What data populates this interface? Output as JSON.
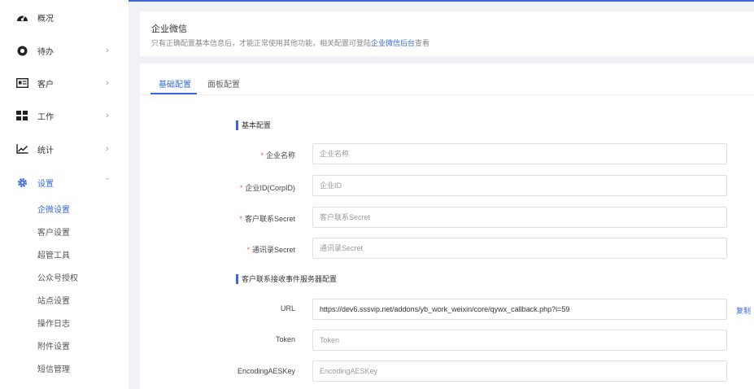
{
  "sidebar": {
    "items": [
      {
        "label": "概况",
        "icon": "dashboard-icon"
      },
      {
        "label": "待办",
        "icon": "todo-icon"
      },
      {
        "label": "客户",
        "icon": "customer-card-icon"
      },
      {
        "label": "工作",
        "icon": "grid-icon"
      },
      {
        "label": "统计",
        "icon": "chart-line-icon"
      },
      {
        "label": "设置",
        "icon": "gear-icon"
      }
    ],
    "arrow_right": "›",
    "arrow_down": "ˇ",
    "sub_items": [
      "企微设置",
      "客户设置",
      "超管工具",
      "公众号授权",
      "站点设置",
      "操作日志",
      "附件设置",
      "短信管理"
    ]
  },
  "header": {
    "title": "企业微信",
    "desc_before": "只有正确配置基本信息后，才能正常使用其他功能，相关配置可登陆",
    "link": "企业微信后台",
    "desc_after": "查看"
  },
  "tabs": [
    "基础配置",
    "面板配置"
  ],
  "sections": {
    "basic": "基本配置",
    "callback": "客户联系接收事件服务器配置"
  },
  "form": {
    "required_mark": "*",
    "corp_name": {
      "label": "企业名称",
      "placeholder": "企业名称"
    },
    "corp_id": {
      "label": "企业ID(CorpID)",
      "placeholder": "企业ID"
    },
    "contact_secret": {
      "label": "客户联系Secret",
      "placeholder": "客户联系Secret"
    },
    "address_secret": {
      "label": "通讯录Secret",
      "placeholder": "通讯录Secret"
    },
    "url": {
      "label": "URL",
      "value": "https://dev6.sssvip.net/addons/yb_work_weixin/core/qywx_callback.php?i=59"
    },
    "token": {
      "label": "Token",
      "placeholder": "Token"
    },
    "aes_key": {
      "label": "EncodingAESKey",
      "placeholder": "EncodingAESKey"
    },
    "copy_label": "复制"
  },
  "colors": {
    "accent": "#3a68d8",
    "required": "#e85555"
  }
}
